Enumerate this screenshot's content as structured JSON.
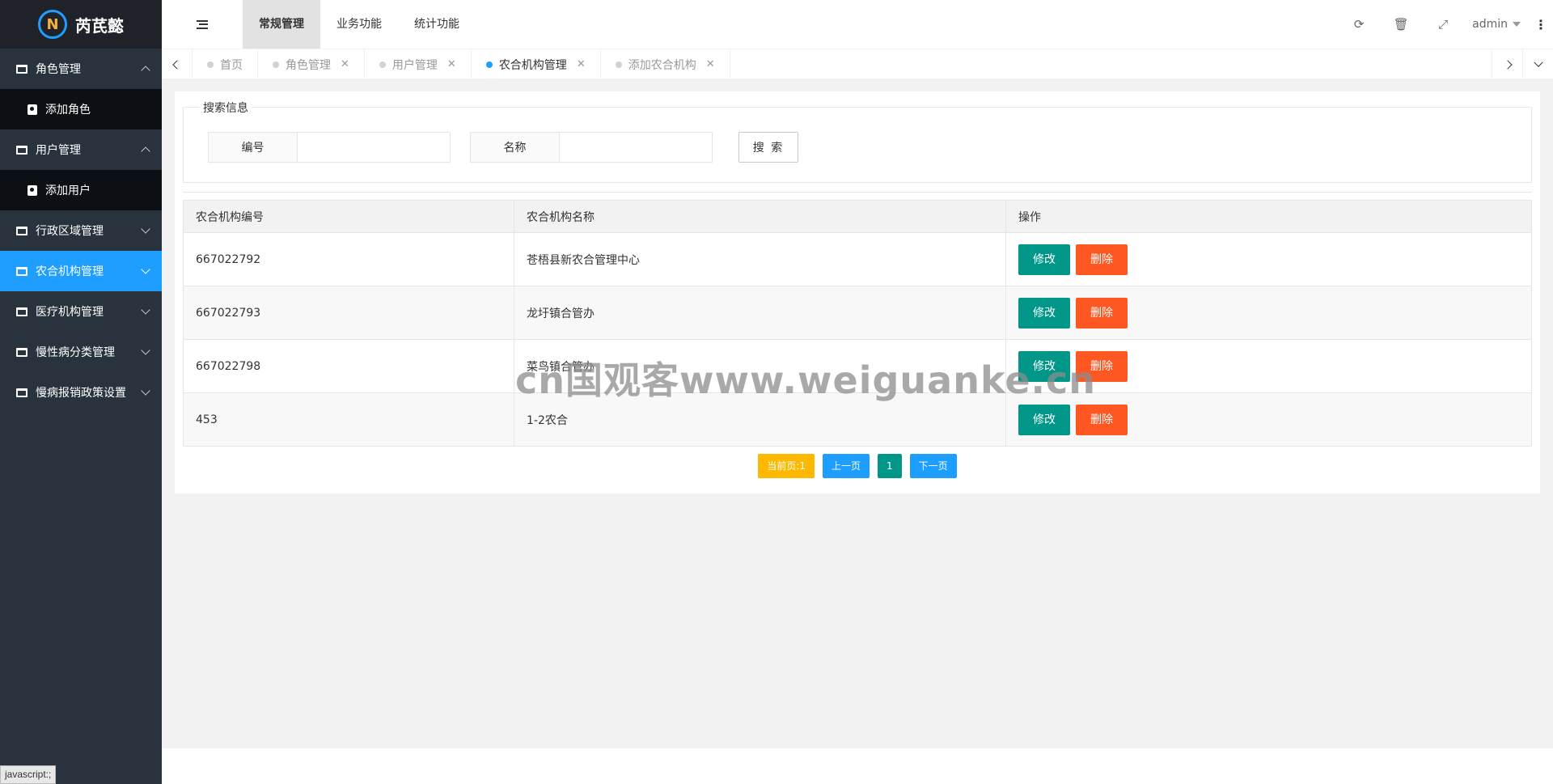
{
  "logo": {
    "mark": "N",
    "text": "芮芪懿"
  },
  "sidebar": {
    "items": [
      {
        "label": "角色管理",
        "expanded": true,
        "children": [
          {
            "label": "添加角色"
          }
        ]
      },
      {
        "label": "用户管理",
        "expanded": true,
        "children": [
          {
            "label": "添加用户"
          }
        ]
      },
      {
        "label": "行政区域管理",
        "expanded": false
      },
      {
        "label": "农合机构管理",
        "expanded": false,
        "active": true
      },
      {
        "label": "医疗机构管理",
        "expanded": false
      },
      {
        "label": "慢性病分类管理",
        "expanded": false
      },
      {
        "label": "慢病报销政策设置",
        "expanded": false
      }
    ]
  },
  "header": {
    "menu": [
      "常规管理",
      "业务功能",
      "统计功能"
    ],
    "active_menu": 0,
    "user": "admin",
    "icons": [
      "refresh-icon",
      "trash-icon",
      "fullscreen-icon"
    ]
  },
  "tabs": [
    {
      "label": "首页",
      "closable": false
    },
    {
      "label": "角色管理",
      "closable": true
    },
    {
      "label": "用户管理",
      "closable": true
    },
    {
      "label": "农合机构管理",
      "closable": true,
      "active": true
    },
    {
      "label": "添加农合机构",
      "closable": true
    }
  ],
  "search": {
    "legend": "搜索信息",
    "field1_label": "编号",
    "field1_value": "",
    "field2_label": "名称",
    "field2_value": "",
    "button": "搜 索"
  },
  "table": {
    "headers": [
      "农合机构编号",
      "农合机构名称",
      "操作"
    ],
    "rows": [
      {
        "id": "667022792",
        "name": "苍梧县新农合管理中心"
      },
      {
        "id": "667022793",
        "name": "龙圩镇合管办"
      },
      {
        "id": "667022798",
        "name": "菜鸟镇合管办"
      },
      {
        "id": "453",
        "name": "1-2农合"
      }
    ],
    "edit_label": "修改",
    "delete_label": "删除"
  },
  "pager": {
    "current": "当前页:1",
    "prev": "上一页",
    "page": "1",
    "next": "下一页"
  },
  "status_text": "javascript:;",
  "watermark": "cn国观客www.weiguanke.cn",
  "colors": {
    "accent": "#1e9fff",
    "edit": "#009688",
    "delete": "#ff5722",
    "current_page": "#ffb800",
    "sidebar": "#28333e"
  }
}
